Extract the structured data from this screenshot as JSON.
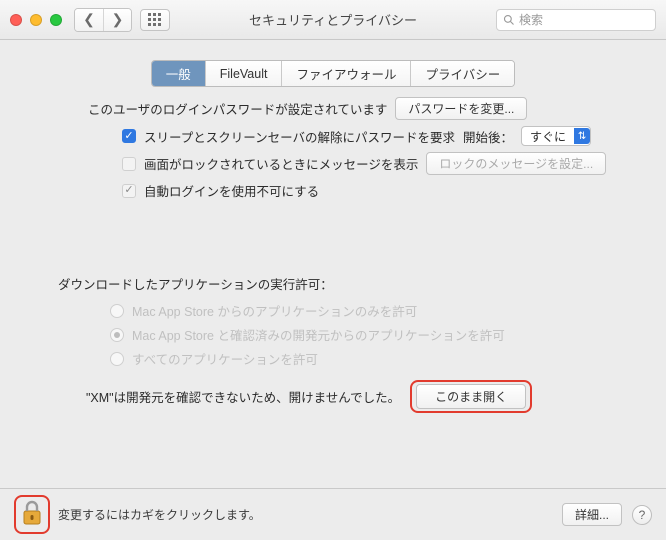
{
  "window": {
    "title": "セキュリティとプライバシー"
  },
  "search": {
    "placeholder": "検索"
  },
  "tabs": [
    "一般",
    "FileVault",
    "ファイアウォール",
    "プライバシー"
  ],
  "section1": {
    "pwdSetLabel": "このユーザのログインパスワードが設定されています",
    "changePwdBtn": "パスワードを変更...",
    "requirePwd": "スリープとスクリーンセーバの解除にパスワードを要求",
    "afterLabel": "開始後：",
    "afterValue": "すぐに",
    "lockMsgLabel": "画面がロックされているときにメッセージを表示",
    "lockMsgBtn": "ロックのメッセージを設定...",
    "disableAutoLogin": "自動ログインを使用不可にする"
  },
  "section2": {
    "title": "ダウンロードしたアプリケーションの実行許可：",
    "opt1": "Mac App Store からのアプリケーションのみを許可",
    "opt2": "Mac App Store と確認済みの開発元からのアプリケーションを許可",
    "opt3": "すべてのアプリケーションを許可",
    "gatekeeperMsg": "\"XM\"は開発元を確認できないため、開けませんでした。",
    "openAnywayBtn": "このまま開く"
  },
  "footer": {
    "lockMsg": "変更するにはカギをクリックします。",
    "detailsBtn": "詳細..."
  }
}
